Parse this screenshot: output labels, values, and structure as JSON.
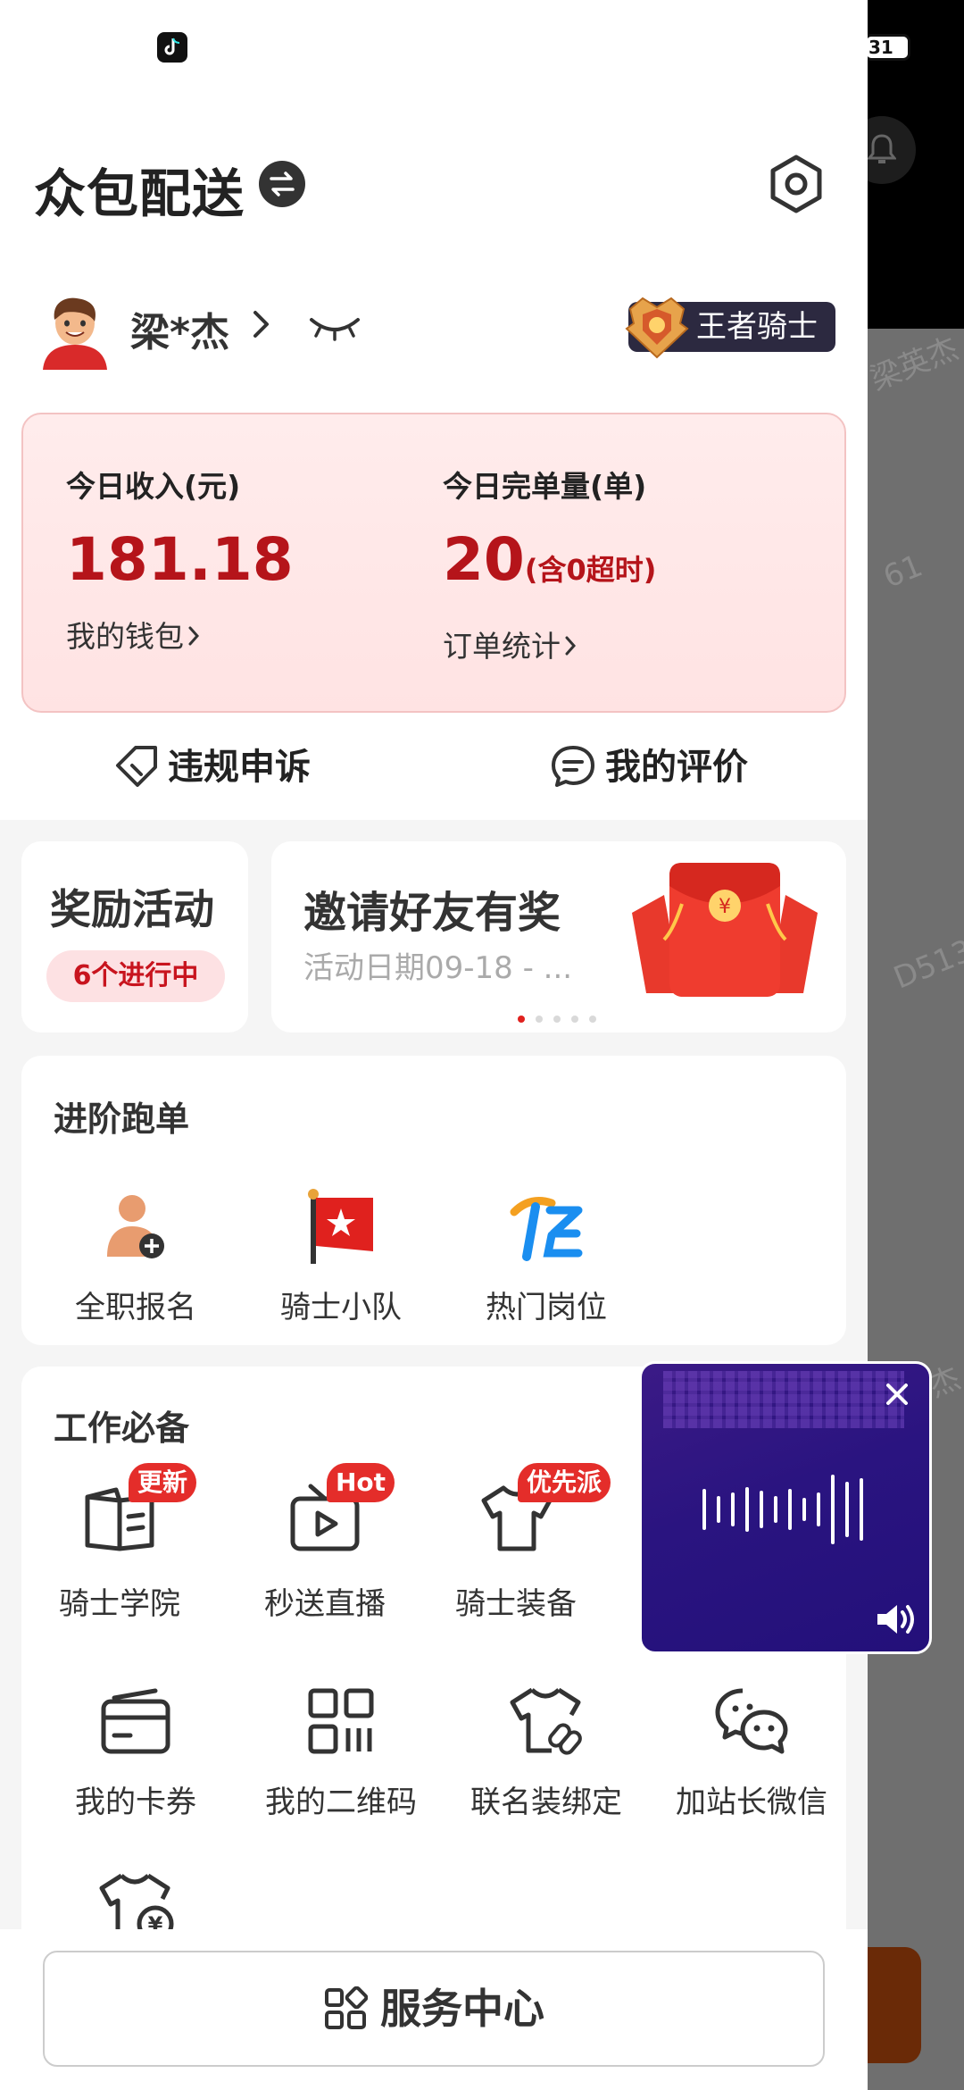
{
  "status": {
    "battery": "31"
  },
  "header": {
    "brand": "众包配送"
  },
  "user": {
    "name": "梁*杰",
    "rank": "王者骑士"
  },
  "stats": {
    "income_label": "今日收入(元)",
    "income_value": "181.18",
    "wallet_link": "我的钱包",
    "orders_label": "今日完单量(单)",
    "orders_value": "20",
    "orders_note": "(含0超时)",
    "orders_link": "订单统计"
  },
  "quick_links": {
    "appeal": "违规申诉",
    "reviews": "我的评价"
  },
  "reward": {
    "title": "奖励活动",
    "badge": "6个进行中"
  },
  "banner": {
    "title": "邀请好友有奖",
    "subtitle": "活动日期09-18 - ...",
    "page_index": 1,
    "page_count": 5
  },
  "advanced": {
    "title": "进阶跑单",
    "items": [
      {
        "label": "全职报名",
        "icon": "person-add-icon"
      },
      {
        "label": "骑士小队",
        "icon": "flag-icon"
      },
      {
        "label": "热门岗位",
        "icon": "job-icon"
      }
    ]
  },
  "essentials": {
    "title": "工作必备",
    "items": [
      {
        "label": "骑士学院",
        "tag": "更新",
        "icon": "book-icon"
      },
      {
        "label": "秒送直播",
        "tag": "Hot",
        "icon": "tv-play-icon"
      },
      {
        "label": "骑士装备",
        "tag": "优先派",
        "icon": "tshirt-icon"
      },
      {
        "label": "我的卡券",
        "tag": "",
        "icon": "card-icon"
      },
      {
        "label": "我的二维码",
        "tag": "",
        "icon": "qrcode-icon"
      },
      {
        "label": "联名装绑定",
        "tag": "",
        "icon": "tshirt-link-icon"
      },
      {
        "label": "加站长微信",
        "tag": "",
        "icon": "wechat-icon"
      }
    ]
  },
  "service": {
    "label": "服务中心"
  },
  "background": {
    "watermark1": "梁英杰",
    "watermark2": "61",
    "watermark3": "D513",
    "watermark4": "杰"
  },
  "colors": {
    "accent_red": "#b5141a",
    "tag_red": "#e42d2a",
    "audio_purple": "#2a1480"
  }
}
